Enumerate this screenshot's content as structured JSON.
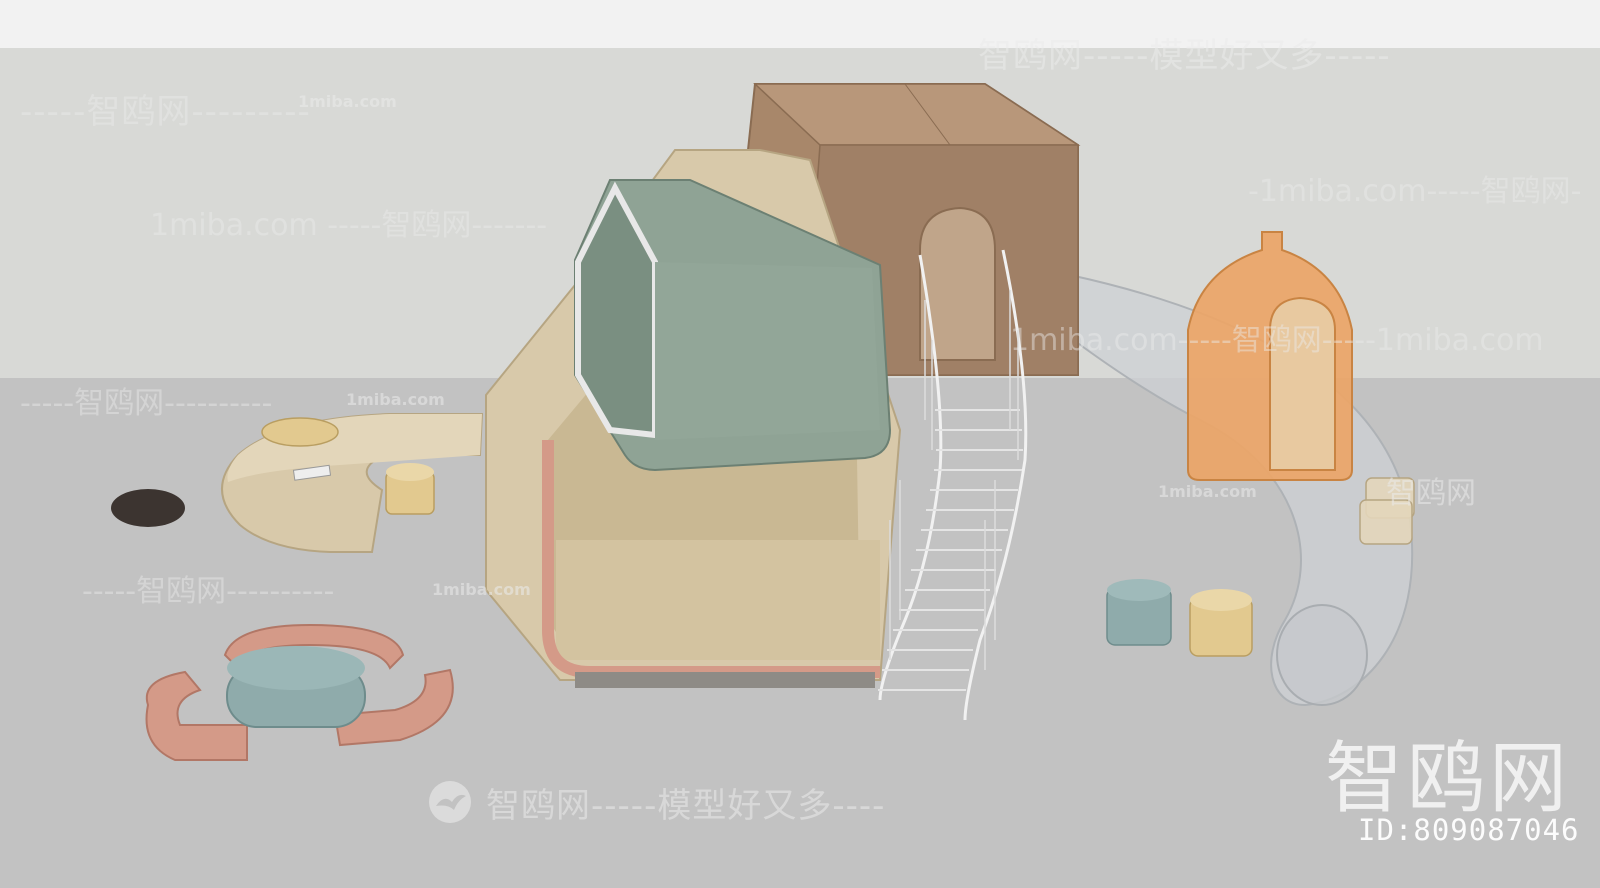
{
  "watermarks": {
    "top_center": "智鸥网-----模型好又多-----",
    "left_top": "-----智鸥网---------",
    "left_top_url": "1miba.com",
    "left_mid_url": "1miba.com -----智鸥网-------",
    "right_top": "-1miba.com-----智鸥网-",
    "left_floor": "-----智鸥网----------",
    "left_floor_url": "1miba.com",
    "center_right": "1miba.com-----智鸥网-----1miba.com",
    "right_mid_url": "1miba.com",
    "right_mid": "智鸥网",
    "left_lower": "-----智鸥网----------",
    "left_lower_url": "1miba.com",
    "bottom_center": "智鸥网-----模型好又多----",
    "corner_title": "智鸥网",
    "corner_id": "ID:809087046"
  },
  "colors": {
    "floor": "#c2c2c2",
    "wall": "#d8d9d6",
    "sky": "#f2f2f2",
    "wood_light": "#d8c9aa",
    "wood_dark": "#a8876a",
    "sage": "#8fa395",
    "terracotta": "#d49a88",
    "teal": "#8fabab",
    "mustard": "#e2c98f",
    "orange": "#eca567",
    "tube": "#cdd0d4"
  },
  "icons": {
    "logo": "seagull-logo-icon"
  }
}
